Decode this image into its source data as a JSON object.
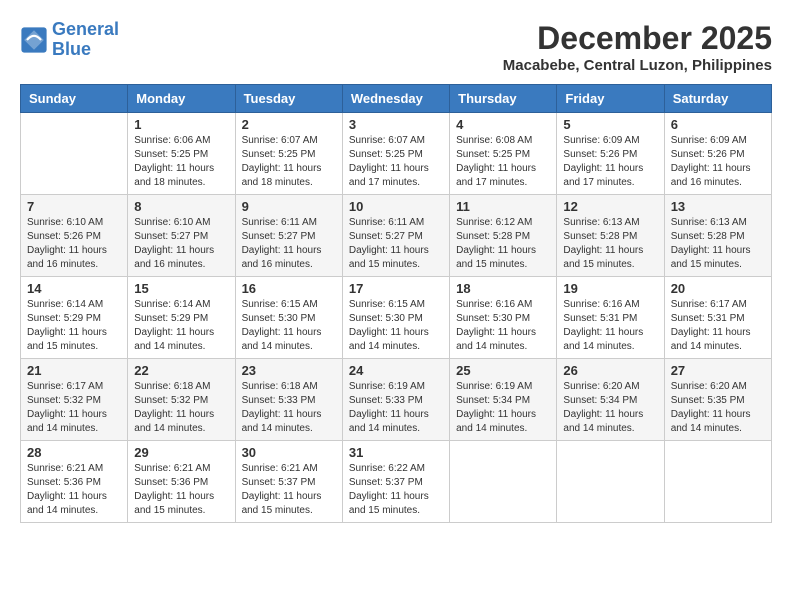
{
  "header": {
    "logo_line1": "General",
    "logo_line2": "Blue",
    "month_year": "December 2025",
    "location": "Macabebe, Central Luzon, Philippines"
  },
  "days_of_week": [
    "Sunday",
    "Monday",
    "Tuesday",
    "Wednesday",
    "Thursday",
    "Friday",
    "Saturday"
  ],
  "weeks": [
    [
      {
        "day": "",
        "sunrise": "",
        "sunset": "",
        "daylight": ""
      },
      {
        "day": "1",
        "sunrise": "Sunrise: 6:06 AM",
        "sunset": "Sunset: 5:25 PM",
        "daylight": "Daylight: 11 hours and 18 minutes."
      },
      {
        "day": "2",
        "sunrise": "Sunrise: 6:07 AM",
        "sunset": "Sunset: 5:25 PM",
        "daylight": "Daylight: 11 hours and 18 minutes."
      },
      {
        "day": "3",
        "sunrise": "Sunrise: 6:07 AM",
        "sunset": "Sunset: 5:25 PM",
        "daylight": "Daylight: 11 hours and 17 minutes."
      },
      {
        "day": "4",
        "sunrise": "Sunrise: 6:08 AM",
        "sunset": "Sunset: 5:25 PM",
        "daylight": "Daylight: 11 hours and 17 minutes."
      },
      {
        "day": "5",
        "sunrise": "Sunrise: 6:09 AM",
        "sunset": "Sunset: 5:26 PM",
        "daylight": "Daylight: 11 hours and 17 minutes."
      },
      {
        "day": "6",
        "sunrise": "Sunrise: 6:09 AM",
        "sunset": "Sunset: 5:26 PM",
        "daylight": "Daylight: 11 hours and 16 minutes."
      }
    ],
    [
      {
        "day": "7",
        "sunrise": "Sunrise: 6:10 AM",
        "sunset": "Sunset: 5:26 PM",
        "daylight": "Daylight: 11 hours and 16 minutes."
      },
      {
        "day": "8",
        "sunrise": "Sunrise: 6:10 AM",
        "sunset": "Sunset: 5:27 PM",
        "daylight": "Daylight: 11 hours and 16 minutes."
      },
      {
        "day": "9",
        "sunrise": "Sunrise: 6:11 AM",
        "sunset": "Sunset: 5:27 PM",
        "daylight": "Daylight: 11 hours and 16 minutes."
      },
      {
        "day": "10",
        "sunrise": "Sunrise: 6:11 AM",
        "sunset": "Sunset: 5:27 PM",
        "daylight": "Daylight: 11 hours and 15 minutes."
      },
      {
        "day": "11",
        "sunrise": "Sunrise: 6:12 AM",
        "sunset": "Sunset: 5:28 PM",
        "daylight": "Daylight: 11 hours and 15 minutes."
      },
      {
        "day": "12",
        "sunrise": "Sunrise: 6:13 AM",
        "sunset": "Sunset: 5:28 PM",
        "daylight": "Daylight: 11 hours and 15 minutes."
      },
      {
        "day": "13",
        "sunrise": "Sunrise: 6:13 AM",
        "sunset": "Sunset: 5:28 PM",
        "daylight": "Daylight: 11 hours and 15 minutes."
      }
    ],
    [
      {
        "day": "14",
        "sunrise": "Sunrise: 6:14 AM",
        "sunset": "Sunset: 5:29 PM",
        "daylight": "Daylight: 11 hours and 15 minutes."
      },
      {
        "day": "15",
        "sunrise": "Sunrise: 6:14 AM",
        "sunset": "Sunset: 5:29 PM",
        "daylight": "Daylight: 11 hours and 14 minutes."
      },
      {
        "day": "16",
        "sunrise": "Sunrise: 6:15 AM",
        "sunset": "Sunset: 5:30 PM",
        "daylight": "Daylight: 11 hours and 14 minutes."
      },
      {
        "day": "17",
        "sunrise": "Sunrise: 6:15 AM",
        "sunset": "Sunset: 5:30 PM",
        "daylight": "Daylight: 11 hours and 14 minutes."
      },
      {
        "day": "18",
        "sunrise": "Sunrise: 6:16 AM",
        "sunset": "Sunset: 5:30 PM",
        "daylight": "Daylight: 11 hours and 14 minutes."
      },
      {
        "day": "19",
        "sunrise": "Sunrise: 6:16 AM",
        "sunset": "Sunset: 5:31 PM",
        "daylight": "Daylight: 11 hours and 14 minutes."
      },
      {
        "day": "20",
        "sunrise": "Sunrise: 6:17 AM",
        "sunset": "Sunset: 5:31 PM",
        "daylight": "Daylight: 11 hours and 14 minutes."
      }
    ],
    [
      {
        "day": "21",
        "sunrise": "Sunrise: 6:17 AM",
        "sunset": "Sunset: 5:32 PM",
        "daylight": "Daylight: 11 hours and 14 minutes."
      },
      {
        "day": "22",
        "sunrise": "Sunrise: 6:18 AM",
        "sunset": "Sunset: 5:32 PM",
        "daylight": "Daylight: 11 hours and 14 minutes."
      },
      {
        "day": "23",
        "sunrise": "Sunrise: 6:18 AM",
        "sunset": "Sunset: 5:33 PM",
        "daylight": "Daylight: 11 hours and 14 minutes."
      },
      {
        "day": "24",
        "sunrise": "Sunrise: 6:19 AM",
        "sunset": "Sunset: 5:33 PM",
        "daylight": "Daylight: 11 hours and 14 minutes."
      },
      {
        "day": "25",
        "sunrise": "Sunrise: 6:19 AM",
        "sunset": "Sunset: 5:34 PM",
        "daylight": "Daylight: 11 hours and 14 minutes."
      },
      {
        "day": "26",
        "sunrise": "Sunrise: 6:20 AM",
        "sunset": "Sunset: 5:34 PM",
        "daylight": "Daylight: 11 hours and 14 minutes."
      },
      {
        "day": "27",
        "sunrise": "Sunrise: 6:20 AM",
        "sunset": "Sunset: 5:35 PM",
        "daylight": "Daylight: 11 hours and 14 minutes."
      }
    ],
    [
      {
        "day": "28",
        "sunrise": "Sunrise: 6:21 AM",
        "sunset": "Sunset: 5:36 PM",
        "daylight": "Daylight: 11 hours and 14 minutes."
      },
      {
        "day": "29",
        "sunrise": "Sunrise: 6:21 AM",
        "sunset": "Sunset: 5:36 PM",
        "daylight": "Daylight: 11 hours and 15 minutes."
      },
      {
        "day": "30",
        "sunrise": "Sunrise: 6:21 AM",
        "sunset": "Sunset: 5:37 PM",
        "daylight": "Daylight: 11 hours and 15 minutes."
      },
      {
        "day": "31",
        "sunrise": "Sunrise: 6:22 AM",
        "sunset": "Sunset: 5:37 PM",
        "daylight": "Daylight: 11 hours and 15 minutes."
      },
      {
        "day": "",
        "sunrise": "",
        "sunset": "",
        "daylight": ""
      },
      {
        "day": "",
        "sunrise": "",
        "sunset": "",
        "daylight": ""
      },
      {
        "day": "",
        "sunrise": "",
        "sunset": "",
        "daylight": ""
      }
    ]
  ]
}
